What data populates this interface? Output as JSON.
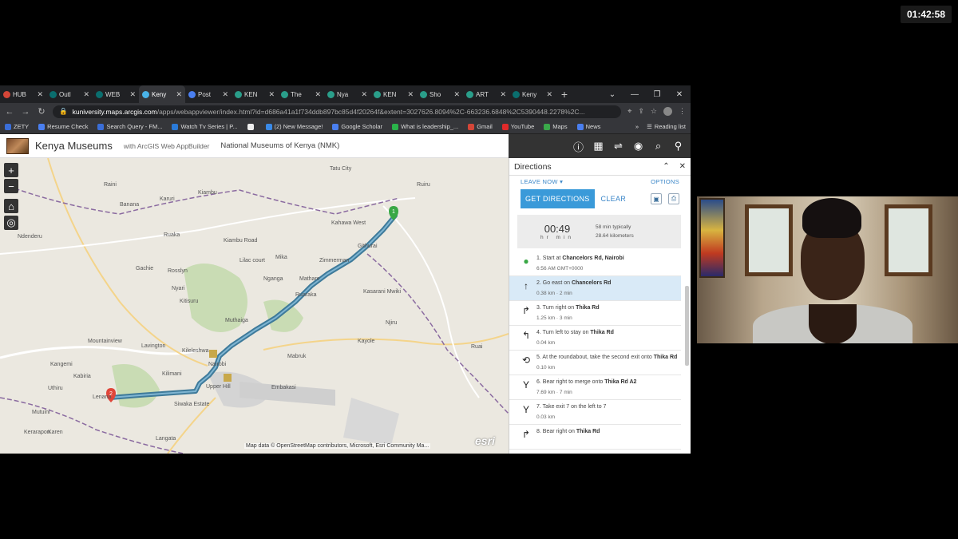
{
  "meeting": {
    "elapsed": "01:42:58"
  },
  "browser": {
    "tabs": [
      {
        "label": "HUB",
        "favicon_color": "#d44638",
        "active": false
      },
      {
        "label": "Outl",
        "favicon_color": "#0a6e6e",
        "active": false
      },
      {
        "label": "WEB",
        "favicon_color": "#0a6e6e",
        "active": false
      },
      {
        "label": "Keny",
        "favicon_color": "#4ab3e8",
        "active": true
      },
      {
        "label": "Post",
        "favicon_color": "#4a7ff0",
        "active": false
      },
      {
        "label": "KEN",
        "favicon_color": "#2a9e8a",
        "active": false
      },
      {
        "label": "The",
        "favicon_color": "#2a9e8a",
        "active": false
      },
      {
        "label": "Nya",
        "favicon_color": "#2a9e8a",
        "active": false
      },
      {
        "label": "KEN",
        "favicon_color": "#2a9e8a",
        "active": false
      },
      {
        "label": "Sho",
        "favicon_color": "#2a9e8a",
        "active": false
      },
      {
        "label": "ART",
        "favicon_color": "#2a9e8a",
        "active": false
      },
      {
        "label": "Keny",
        "favicon_color": "#0a6e6e",
        "active": false
      }
    ],
    "url_host": "kuniversity.maps.arcgis.com",
    "url_path": "/apps/webappviewer/index.html?id=d686a41a1f734ddb897bc85d4f20264f&extent=3027626.8094%2C-663236.6848%2C5390448.2278%2C...",
    "bookmarks": [
      {
        "label": "ZETY",
        "color": "#3a6ed8"
      },
      {
        "label": "Resume Check",
        "color": "#4a7ff0"
      },
      {
        "label": "Search Query - FM...",
        "color": "#3a6ed8"
      },
      {
        "label": "Watch Tv Series | P...",
        "color": "#2a7ad8"
      },
      {
        "label": "",
        "color": "#eeeeee"
      },
      {
        "label": "(2) New Message!",
        "color": "#3a8ae8"
      },
      {
        "label": "Google Scholar",
        "color": "#4a7ff0"
      },
      {
        "label": "What is leadership_...",
        "color": "#2ab34a"
      },
      {
        "label": "Gmail",
        "color": "#d44638"
      },
      {
        "label": "YouTube",
        "color": "#e02a2a"
      },
      {
        "label": "Maps",
        "color": "#3aa84a"
      },
      {
        "label": "News",
        "color": "#4a7ff0"
      }
    ],
    "reading_list": "Reading list"
  },
  "app": {
    "title": "Kenya Museums",
    "subtitle": "with ArcGIS Web AppBuilder",
    "org": "National Museums of Kenya (NMK)"
  },
  "map": {
    "attribution": "Map data © OpenStreetMap contributors, Microsoft, Esri Community Ma...",
    "brand": "esri",
    "labels": [
      "Tatu City",
      "Kiambu",
      "Ndenderu",
      "Banana",
      "Raini",
      "Karuri",
      "Kahawa West",
      "Githurai",
      "Zimmerman",
      "Kasarani Mwiki",
      "Ruaka",
      "Gachie",
      "Rosslyn",
      "Nyari",
      "Kitisuru",
      "Lilac court",
      "Mika",
      "Ruaraka",
      "Mathare",
      "Kileleshwa",
      "Nairobi",
      "Kilimani",
      "Upper Hill",
      "Lenana",
      "Kabiria",
      "Karen",
      "Langata",
      "Siwaka Estate",
      "Embakasi",
      "Njiru",
      "Ruai",
      "Kayole",
      "Mountainview",
      "Lavington",
      "Kangemi",
      "Uthiru",
      "Mutuini",
      "Ruiru",
      "Nganga",
      "Muthaiga",
      "Mabruk",
      "Kerarapon",
      "Kiambu Road"
    ]
  },
  "panel": {
    "title": "Directions",
    "leave_now": "LEAVE NOW ▾",
    "options": "OPTIONS",
    "get_directions": "GET DIRECTIONS",
    "clear": "CLEAR",
    "summary": {
      "time": "00:49",
      "units": "hr min",
      "typical": "58 min typically",
      "distance": "28.64 kilometers"
    },
    "steps": [
      {
        "n": "1.",
        "text": "Start at",
        "road": "Chancelors Rd, Nairobi",
        "sub": "6:56 AM GMT+0000",
        "icon": "start-pin-icon",
        "glyph": "●",
        "highlight": false
      },
      {
        "n": "2.",
        "text": "Go east on",
        "road": "Chancelors Rd",
        "sub": "0.38 km · 2 min",
        "icon": "straight-arrow-icon",
        "glyph": "↑",
        "highlight": true
      },
      {
        "n": "3.",
        "text": "Turn right on",
        "road": "Thika Rd",
        "sub": "1.25 km · 3 min",
        "icon": "turn-right-icon",
        "glyph": "↱",
        "highlight": false
      },
      {
        "n": "4.",
        "text": "Turn left to stay on",
        "road": "Thika Rd",
        "sub": "0.04 km",
        "icon": "turn-left-icon",
        "glyph": "↰",
        "highlight": false
      },
      {
        "n": "5.",
        "text": "At the roundabout, take the second exit onto",
        "road": "Thika Rd",
        "sub": "0.10 km",
        "icon": "roundabout-icon",
        "glyph": "⟲",
        "highlight": false
      },
      {
        "n": "6.",
        "text": "Bear right to merge onto",
        "road": "Thika Rd  A2",
        "sub": "7.69 km · 7 min",
        "icon": "bear-right-icon",
        "glyph": "Y",
        "highlight": false
      },
      {
        "n": "7.",
        "text": "Take exit 7 on the left to 7",
        "road": "",
        "sub": "0.03 km",
        "icon": "exit-left-icon",
        "glyph": "Y",
        "highlight": false
      },
      {
        "n": "8.",
        "text": "Bear right on",
        "road": "Thika Rd",
        "sub": "",
        "icon": "bear-right-icon",
        "glyph": "↱",
        "highlight": false
      }
    ]
  }
}
